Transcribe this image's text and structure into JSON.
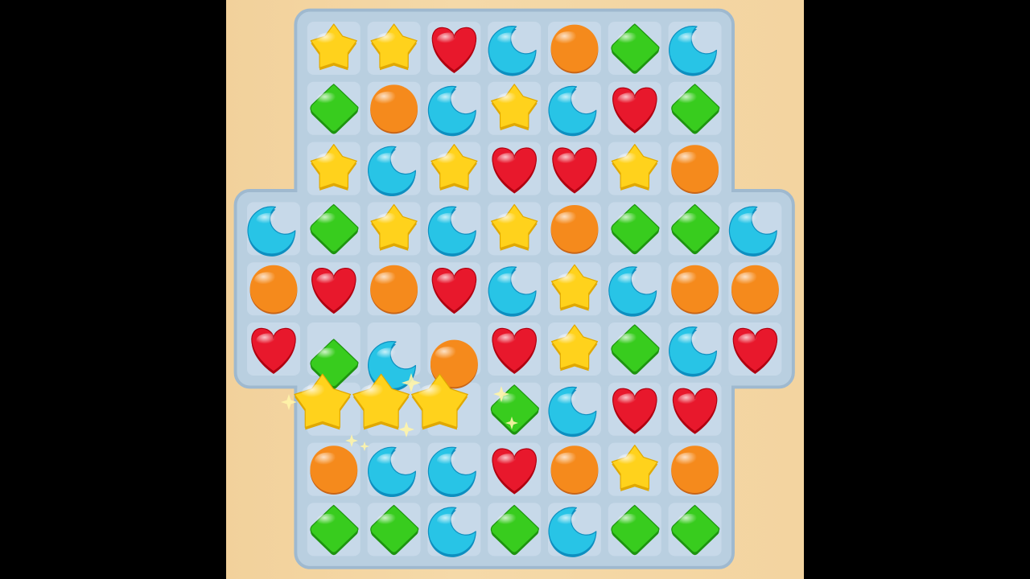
{
  "colors": {
    "background_wood": "#f3d4a0",
    "board_fill": "#b9cfe0",
    "board_border": "#9fb9cf",
    "cell_fill": "#c9daea",
    "yellow": "#ffd21c",
    "blue": "#28c4e6",
    "red": "#e8182c",
    "orange": "#f58a1c",
    "green": "#38cc1e"
  },
  "pieces": {
    "Y": {
      "name": "yellow-star-candy",
      "color": "yellow"
    },
    "B": {
      "name": "blue-moon-candy",
      "color": "blue"
    },
    "R": {
      "name": "red-heart-candy",
      "color": "red"
    },
    "O": {
      "name": "orange-round-candy",
      "color": "orange"
    },
    "G": {
      "name": "green-diamond-candy",
      "color": "green"
    }
  },
  "board": {
    "rows": [
      [
        "",
        "Y",
        "Y",
        "R",
        "B",
        "O",
        "G",
        "B",
        ""
      ],
      [
        "",
        "G",
        "O",
        "B",
        "Y",
        "B",
        "R",
        "G",
        ""
      ],
      [
        "",
        "Y",
        "B",
        "Y",
        "R",
        "R",
        "Y",
        "O",
        ""
      ],
      [
        "B",
        "G",
        "Y",
        "B",
        "Y",
        "O",
        "G",
        "G",
        "B"
      ],
      [
        "O",
        "R",
        "O",
        "R",
        "B",
        "Y",
        "B",
        "O",
        "O"
      ],
      [
        "R",
        "G",
        "B",
        "O",
        "R",
        "Y",
        "G",
        "B",
        "R"
      ],
      [
        "",
        "Y",
        "Y",
        "Y",
        "G",
        "B",
        "R",
        "R",
        ""
      ],
      [
        "",
        "O",
        "B",
        "B",
        "R",
        "O",
        "Y",
        "O",
        ""
      ],
      [
        "",
        "G",
        "G",
        "B",
        "G",
        "B",
        "G",
        "G",
        ""
      ]
    ],
    "matching_row": 6,
    "matching_cols": [
      1,
      2,
      3
    ]
  }
}
